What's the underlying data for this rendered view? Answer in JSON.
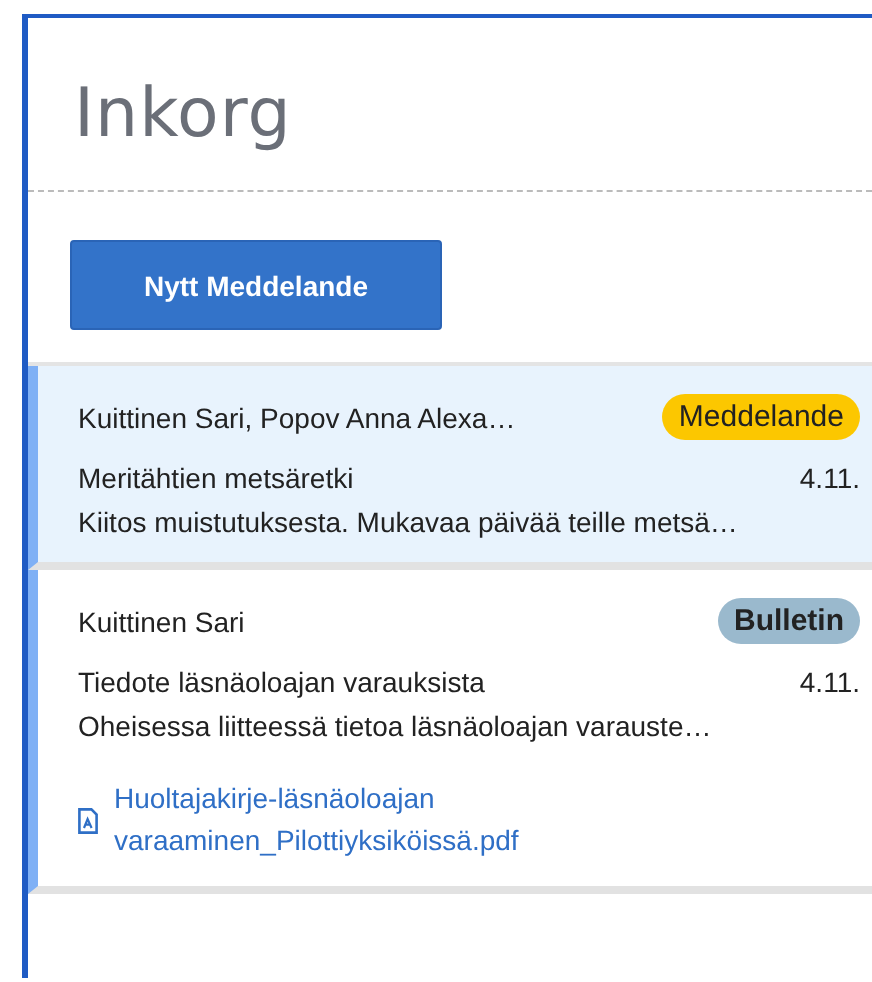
{
  "title": "Inkorg",
  "new_button": "Nytt Meddelande",
  "messages": [
    {
      "sender": "Kuittinen Sari, Popov Anna Alexa…",
      "badge": "Meddelande",
      "kind": "message",
      "subject": "Meritähtien metsäretki",
      "date": "4.11.",
      "preview": "Kiitos muistutuksesta. Mukavaa päivää teille metsä…",
      "selected": true
    },
    {
      "sender": "Kuittinen Sari",
      "badge": "Bulletin",
      "kind": "bulletin",
      "subject": "Tiedote läsnäoloajan varauksista",
      "date": "4.11.",
      "preview": "Oheisessa liitteessä tietoa läsnäoloajan varauste…",
      "selected": false,
      "attachment": "Huoltajakirje-läsnäoloajan varaaminen_Pilottiyksiköissä.pdf"
    }
  ]
}
